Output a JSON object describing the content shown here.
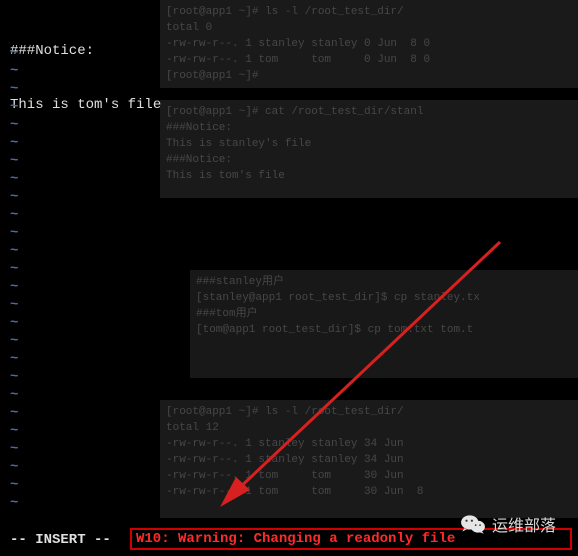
{
  "file": {
    "line1": "###Notice:",
    "line2": "This is tom's file"
  },
  "tilde": "~",
  "tilde_count": 26,
  "bg_panels": {
    "p1": "[root@app1 ~]# ls -l /root_test_dir/\ntotal 0\n-rw-rw-r--. 1 stanley stanley 0 Jun  8 0\n-rw-rw-r--. 1 tom     tom     0 Jun  8 0\n[root@app1 ~]#",
    "p2": "[root@app1 ~]# cat /root_test_dir/stanl\n###Notice:\nThis is stanley's file\n###Notice:\nThis is tom's file",
    "p3": "###stanley用户\n[stanley@app1 root_test_dir]$ cp stanley.tx\n###tom用户\n[tom@app1 root_test_dir]$ cp tom.txt tom.t",
    "p4": "[root@app1 ~]# ls -l /root_test_dir/\ntotal 12\n-rw-rw-r--. 1 stanley stanley 34 Jun\n-rw-rw-r--. 1 stanley stanley 34 Jun\n-rw-rw-r--. 1 tom     tom     30 Jun\n-rw-rw-r--. 1 tom     tom     30 Jun  8"
  },
  "status": {
    "mode": "-- INSERT --",
    "warning": "W10: Warning: Changing a readonly file"
  },
  "watermark": {
    "label": "运维部落"
  }
}
